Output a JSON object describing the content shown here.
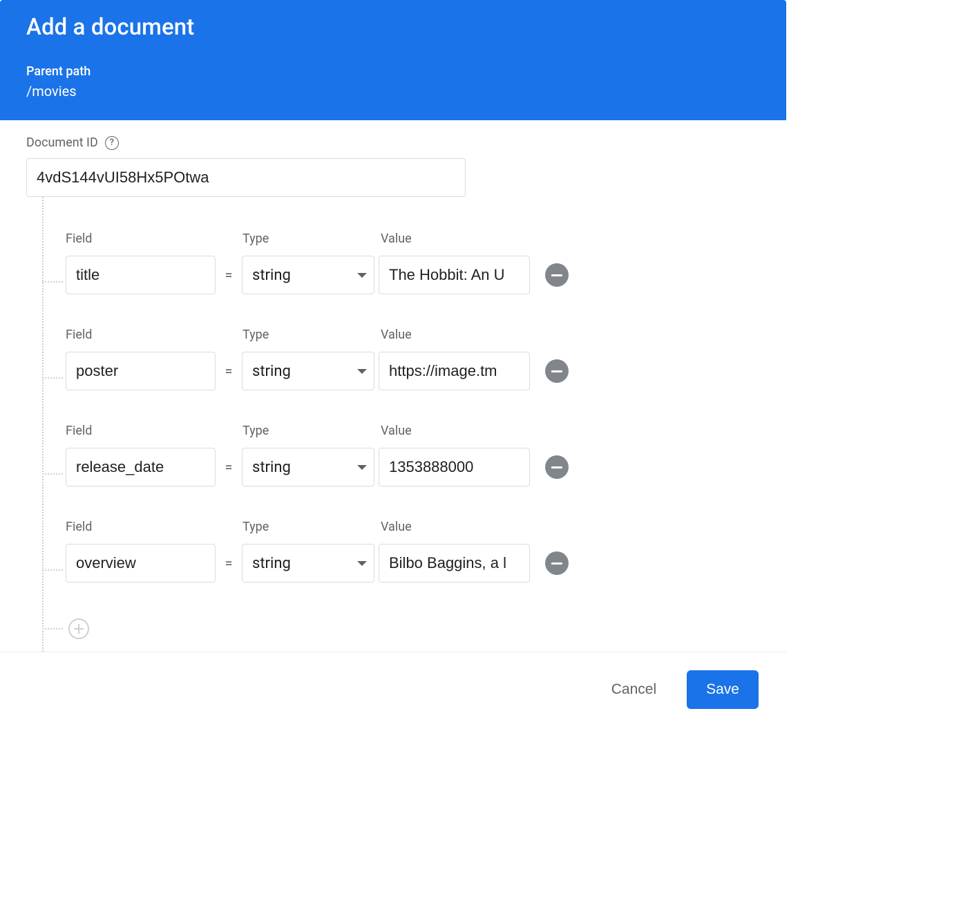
{
  "header": {
    "title": "Add a document",
    "parent_path_label": "Parent path",
    "parent_path_value": "/movies"
  },
  "document_id": {
    "label": "Document ID",
    "value": "4vdS144vUI58Hx5POtwa"
  },
  "labels": {
    "field": "Field",
    "type": "Type",
    "value": "Value"
  },
  "fields": [
    {
      "name": "title",
      "type": "string",
      "value": "The Hobbit: An U"
    },
    {
      "name": "poster",
      "type": "string",
      "value": "https://image.tm"
    },
    {
      "name": "release_date",
      "type": "string",
      "value": "1353888000"
    },
    {
      "name": "overview",
      "type": "string",
      "value": "Bilbo Baggins, a l"
    }
  ],
  "footer": {
    "cancel": "Cancel",
    "save": "Save"
  }
}
